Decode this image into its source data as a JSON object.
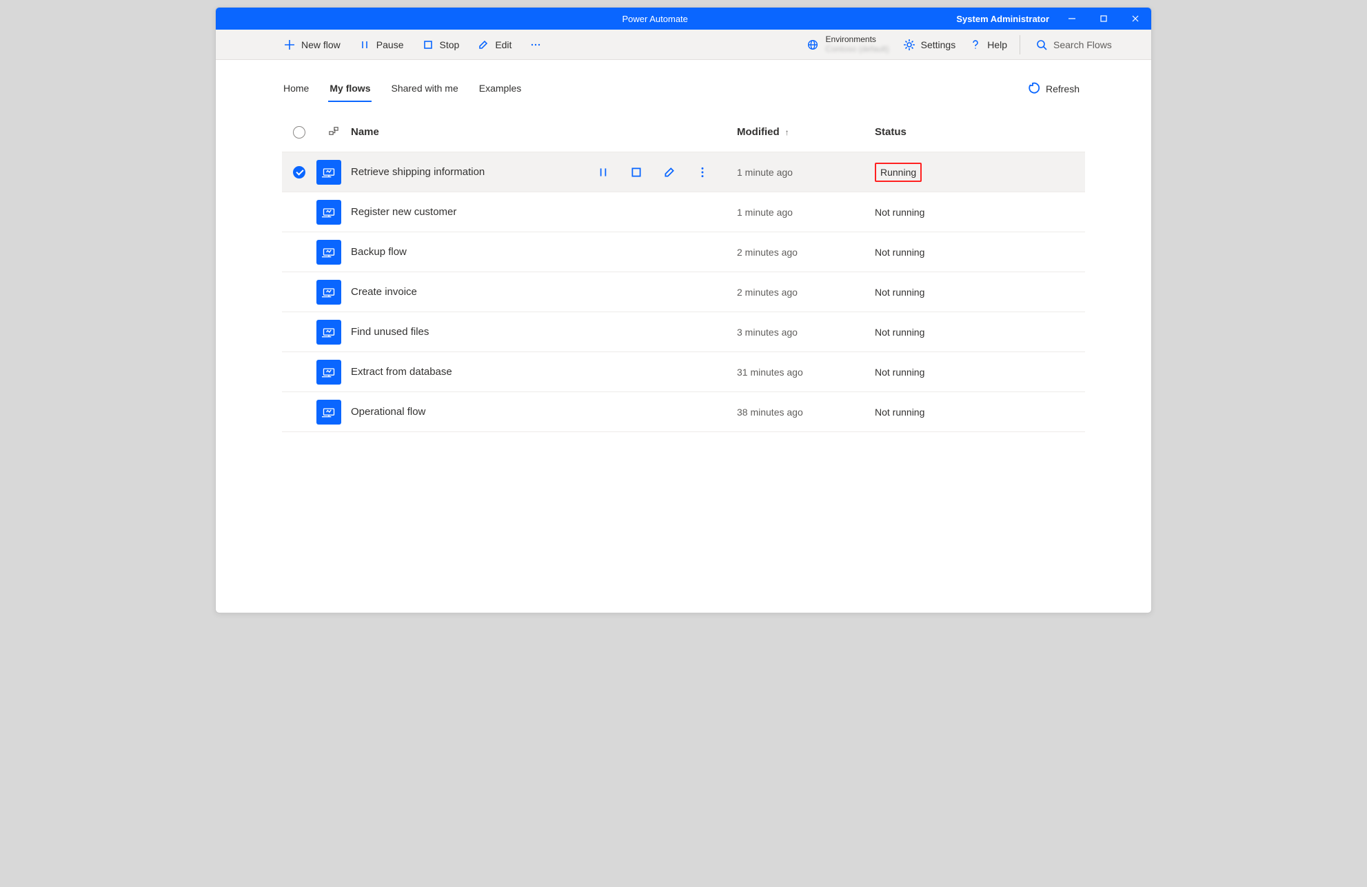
{
  "titlebar": {
    "app_title": "Power Automate",
    "user": "System Administrator"
  },
  "commands": {
    "new_flow": "New flow",
    "pause": "Pause",
    "stop": "Stop",
    "edit": "Edit"
  },
  "env": {
    "label": "Environments",
    "name": "Contoso (default)"
  },
  "settings_label": "Settings",
  "help_label": "Help",
  "search_placeholder": "Search Flows",
  "tabs": {
    "home": "Home",
    "my_flows": "My flows",
    "shared": "Shared with me",
    "examples": "Examples"
  },
  "refresh_label": "Refresh",
  "columns": {
    "name": "Name",
    "modified": "Modified",
    "status": "Status"
  },
  "rows": [
    {
      "name": "Retrieve shipping information",
      "modified": "1 minute ago",
      "status": "Running",
      "selected": true,
      "highlight": true
    },
    {
      "name": "Register new customer",
      "modified": "1 minute ago",
      "status": "Not running",
      "selected": false,
      "highlight": false
    },
    {
      "name": "Backup flow",
      "modified": "2 minutes ago",
      "status": "Not running",
      "selected": false,
      "highlight": false
    },
    {
      "name": "Create invoice",
      "modified": "2 minutes ago",
      "status": "Not running",
      "selected": false,
      "highlight": false
    },
    {
      "name": "Find unused files",
      "modified": "3 minutes ago",
      "status": "Not running",
      "selected": false,
      "highlight": false
    },
    {
      "name": "Extract from database",
      "modified": "31 minutes ago",
      "status": "Not running",
      "selected": false,
      "highlight": false
    },
    {
      "name": "Operational flow",
      "modified": "38 minutes ago",
      "status": "Not running",
      "selected": false,
      "highlight": false
    }
  ]
}
